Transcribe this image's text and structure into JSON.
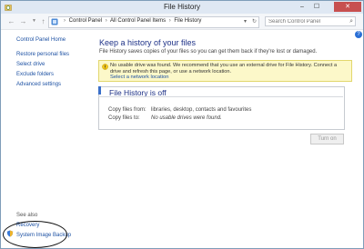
{
  "window": {
    "title": "File History",
    "buttons": {
      "minimize": "–",
      "maximize": "☐",
      "close": "✕"
    }
  },
  "navbar": {
    "back": "←",
    "forward": "→",
    "recent": "▼",
    "up": "↑",
    "breadcrumbs": [
      "Control Panel",
      "All Control Panel Items",
      "File History"
    ],
    "separator": "›",
    "dropdown": "▾",
    "refresh": "↻",
    "search_placeholder": "Search Control Panel",
    "search_glyph": "⌕"
  },
  "help_glyph": "?",
  "sidebar": {
    "home": "Control Panel Home",
    "links": [
      "Restore personal files",
      "Select drive",
      "Exclude folders",
      "Advanced settings"
    ],
    "see_also": "See also",
    "recovery": "Recovery",
    "system_image_backup": "System Image Backup"
  },
  "main": {
    "heading": "Keep a history of your files",
    "description": "File History saves copies of your files so you can get them back if they're lost or damaged.",
    "warning": {
      "text": "No usable drive was found. We recommend that you use an external drive for File History. Connect a drive and refresh this page, or use a network location.",
      "link": "Select a network location"
    },
    "status": {
      "title": "File History is off",
      "copy_from_label": "Copy files from:",
      "copy_from_value": "libraries, desktop, contacts and favourites",
      "copy_to_label": "Copy files to:",
      "copy_to_value": "No usable drives were found."
    },
    "turn_on_label": "Turn on"
  },
  "colors": {
    "accent": "#1e3287",
    "link": "#1d51a3",
    "warning_bg": "#fcf8c9",
    "close_btn": "#c75050"
  },
  "icons": [
    "file-history-icon",
    "control-panel-icon",
    "search-icon",
    "help-icon",
    "warning-icon",
    "shield-icon"
  ]
}
